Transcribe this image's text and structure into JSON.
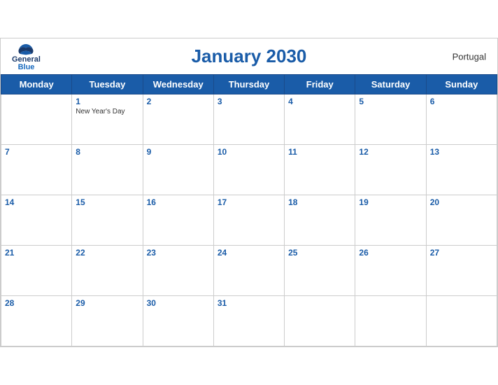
{
  "header": {
    "title": "January 2030",
    "country": "Portugal",
    "logo": {
      "general": "General",
      "blue": "Blue"
    }
  },
  "weekdays": [
    "Monday",
    "Tuesday",
    "Wednesday",
    "Thursday",
    "Friday",
    "Saturday",
    "Sunday"
  ],
  "weeks": [
    [
      {
        "day": "",
        "holiday": ""
      },
      {
        "day": "1",
        "holiday": "New Year's Day"
      },
      {
        "day": "2",
        "holiday": ""
      },
      {
        "day": "3",
        "holiday": ""
      },
      {
        "day": "4",
        "holiday": ""
      },
      {
        "day": "5",
        "holiday": ""
      },
      {
        "day": "6",
        "holiday": ""
      }
    ],
    [
      {
        "day": "7",
        "holiday": ""
      },
      {
        "day": "8",
        "holiday": ""
      },
      {
        "day": "9",
        "holiday": ""
      },
      {
        "day": "10",
        "holiday": ""
      },
      {
        "day": "11",
        "holiday": ""
      },
      {
        "day": "12",
        "holiday": ""
      },
      {
        "day": "13",
        "holiday": ""
      }
    ],
    [
      {
        "day": "14",
        "holiday": ""
      },
      {
        "day": "15",
        "holiday": ""
      },
      {
        "day": "16",
        "holiday": ""
      },
      {
        "day": "17",
        "holiday": ""
      },
      {
        "day": "18",
        "holiday": ""
      },
      {
        "day": "19",
        "holiday": ""
      },
      {
        "day": "20",
        "holiday": ""
      }
    ],
    [
      {
        "day": "21",
        "holiday": ""
      },
      {
        "day": "22",
        "holiday": ""
      },
      {
        "day": "23",
        "holiday": ""
      },
      {
        "day": "24",
        "holiday": ""
      },
      {
        "day": "25",
        "holiday": ""
      },
      {
        "day": "26",
        "holiday": ""
      },
      {
        "day": "27",
        "holiday": ""
      }
    ],
    [
      {
        "day": "28",
        "holiday": ""
      },
      {
        "day": "29",
        "holiday": ""
      },
      {
        "day": "30",
        "holiday": ""
      },
      {
        "day": "31",
        "holiday": ""
      },
      {
        "day": "",
        "holiday": ""
      },
      {
        "day": "",
        "holiday": ""
      },
      {
        "day": "",
        "holiday": ""
      }
    ]
  ]
}
